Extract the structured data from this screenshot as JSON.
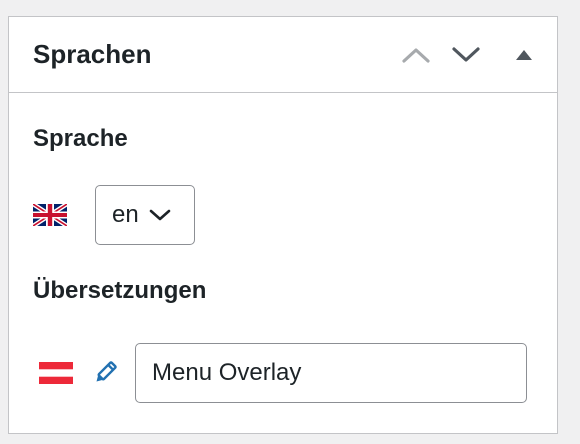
{
  "panel": {
    "title": "Sprachen",
    "actions": [
      {
        "name": "move-up",
        "icon": "chevron-up-icon"
      },
      {
        "name": "move-down",
        "icon": "chevron-down-icon"
      },
      {
        "name": "toggle-panel",
        "icon": "triangle-up-icon"
      }
    ]
  },
  "language": {
    "label": "Sprache",
    "flag": "uk-flag-icon",
    "selected": "en"
  },
  "translations": {
    "label": "Übersetzungen",
    "items": [
      {
        "flag": "austria-flag-icon",
        "edit_icon": "pencil-icon",
        "value": "Menu Overlay"
      }
    ]
  },
  "colors": {
    "border": "#c3c4c7",
    "text": "#1d2327",
    "icon_muted": "#a7aaad",
    "icon_dark": "#50575e",
    "pencil": "#2271b1",
    "austria_red": "#ed2939"
  }
}
